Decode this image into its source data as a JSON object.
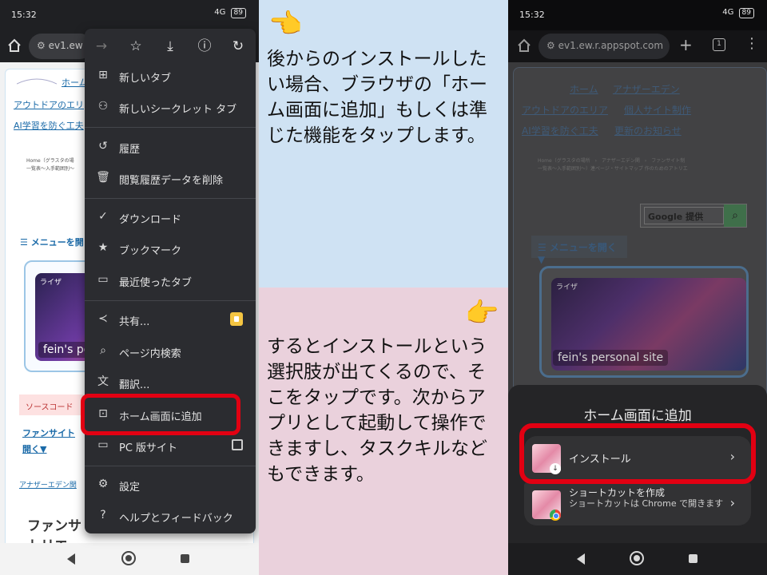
{
  "left_phone": {
    "status": {
      "time": "15:32",
      "network": "4G",
      "battery": "89"
    },
    "address": {
      "url": "ev1.ew"
    },
    "webpage": {
      "nav_home": "ホーム",
      "nav_links": [
        "アウトドアのエリ",
        "AI学習を防ぐ工夫"
      ],
      "breadcrumb_1": "Home（グラスタの場",
      "breadcrumb_2": "一覧表〜入手範囲別〜",
      "menu_toggle": "☰ メニューを開",
      "banner_tag": "ライザ",
      "banner_text": "fein's pe",
      "source_code": "ソースコード",
      "fansite_1": "ファンサイト",
      "fansite_2": "開く▼",
      "footer_link": "アナザーエデン関",
      "heading_1": "ファンサ",
      "heading_2": "トリエ"
    },
    "chrome_menu": {
      "items": [
        {
          "label": "新しいタブ",
          "icon": "new-tab-icon"
        },
        {
          "label": "新しいシークレット タブ",
          "icon": "incognito-icon"
        },
        {
          "label": "履歴",
          "icon": "history-icon"
        },
        {
          "label": "閲覧履歴データを削除",
          "icon": "trash-icon"
        },
        {
          "label": "ダウンロード",
          "icon": "downloads-icon"
        },
        {
          "label": "ブックマーク",
          "icon": "star-icon"
        },
        {
          "label": "最近使ったタブ",
          "icon": "devices-icon"
        },
        {
          "label": "共有...",
          "icon": "share-icon"
        },
        {
          "label": "ページ内検索",
          "icon": "find-in-page-icon"
        },
        {
          "label": "翻訳...",
          "icon": "translate-icon"
        },
        {
          "label": "ホーム画面に追加",
          "icon": "add-to-home-icon"
        },
        {
          "label": "PC 版サイト",
          "icon": "desktop-icon"
        },
        {
          "label": "設定",
          "icon": "gear-icon"
        },
        {
          "label": "ヘルプとフィードバック",
          "icon": "help-icon"
        }
      ]
    }
  },
  "middle": {
    "top_text": "後からのインストールしたい場合、ブラウザの「ホーム画面に追加」もしくは準じた機能をタップします。",
    "bottom_text": "するとインストールという選択肢が出てくるので、そこをタップです。次からアプリとして起動して操作できますし、タスクキルなどもできます。",
    "top_color": "#cfe2f3",
    "bottom_color": "#ead1dc"
  },
  "right_phone": {
    "status": {
      "time": "15:32",
      "network": "4G",
      "battery": "89"
    },
    "address": {
      "url": "ev1.ew.r.appspot.com",
      "tab_count": "1"
    },
    "webpage": {
      "nav": [
        "ホーム",
        "アナザーエデン"
      ],
      "links_row1": [
        "アウトドアのエリア",
        "個人サイト制作"
      ],
      "links_row2": [
        "AI学習を防ぐ工夫",
        "更新のお知らせ"
      ],
      "breadcrumb_1": "Home（グラスタの場所　›　アナザーエデン関　›　ファンサイト制",
      "breadcrumb_2": "一覧表〜入手範囲別〜）連ページ・サイトマップ 作のためのアトリエ",
      "google_label": "Google 提供",
      "menu_toggle": "☰ メニューを開く ▼",
      "banner_tag": "ライザ",
      "banner_text": "fein's personal site"
    },
    "sheet": {
      "title": "ホーム画面に追加",
      "install_label": "インストール",
      "shortcut_title": "ショートカットを作成",
      "shortcut_sub": "ショートカットは Chrome で開きます"
    }
  },
  "colors": {
    "highlight": "#e20012"
  }
}
